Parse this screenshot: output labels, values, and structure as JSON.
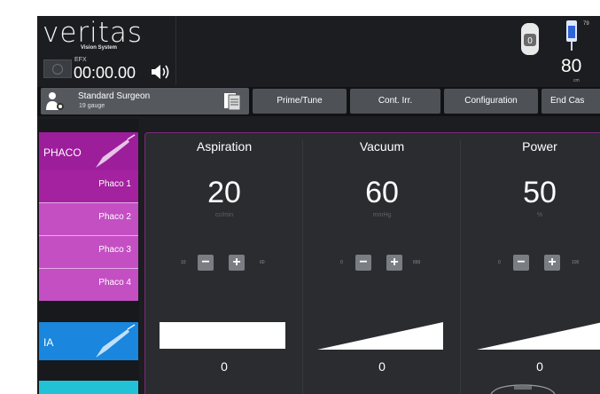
{
  "header": {
    "brand": "veritas",
    "brand_sub": "Vision System",
    "efx_label": "EFX",
    "timer": "00:00.00",
    "bottle_level": "79",
    "height_value": "80",
    "height_unit": "cm",
    "icons": [
      "stop-icon",
      "speaker-icon",
      "handpiece-icon",
      "bottle-icon"
    ]
  },
  "toolbar": {
    "surgeon_name": "Standard Surgeon",
    "surgeon_gauge": "19 gauge",
    "buttons": [
      "Prime/Tune",
      "Cont. Irr.",
      "Configuration",
      "End Cas"
    ]
  },
  "sidebar": {
    "phaco_label": "PHACO",
    "phaco_items": [
      "Phaco 1",
      "Phaco 2",
      "Phaco 3",
      "Phaco 4"
    ],
    "phaco_colors": [
      "#9c1e9b",
      "#c44fc3",
      "#c44fc3",
      "#c44fc3"
    ],
    "ia_label": "IA"
  },
  "controls": [
    {
      "title": "Aspiration",
      "value": "20",
      "unit": "cc/min",
      "min": "10",
      "max": "60",
      "bottom": "0",
      "indicator": "bar"
    },
    {
      "title": "Vacuum",
      "value": "60",
      "unit": "mmHg",
      "min": "0",
      "max": "650",
      "bottom": "0",
      "indicator": "ramp"
    },
    {
      "title": "Power",
      "value": "50",
      "unit": "%",
      "min": "0",
      "max": "100",
      "bottom": "0",
      "indicator": "ramp"
    }
  ]
}
